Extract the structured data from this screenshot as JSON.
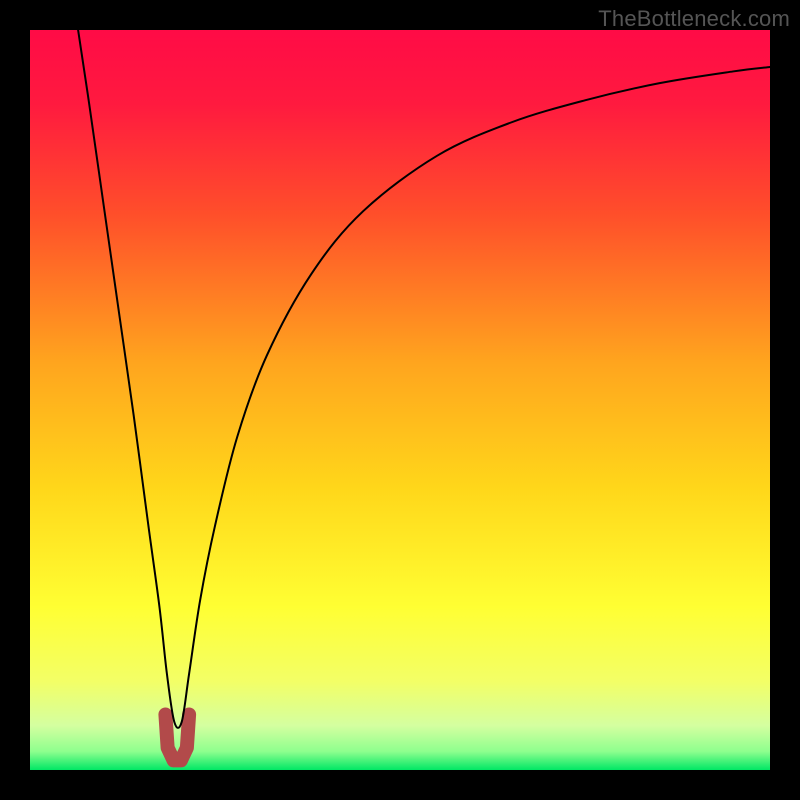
{
  "watermark": "TheBottleneck.com",
  "chart_data": {
    "type": "line",
    "title": "",
    "xlabel": "",
    "ylabel": "",
    "xlim": [
      0,
      100
    ],
    "ylim": [
      0,
      100
    ],
    "gradient_stops": [
      {
        "offset": 0.0,
        "color": "#ff0b46"
      },
      {
        "offset": 0.1,
        "color": "#ff1a3f"
      },
      {
        "offset": 0.25,
        "color": "#ff4f2a"
      },
      {
        "offset": 0.45,
        "color": "#ffa51e"
      },
      {
        "offset": 0.62,
        "color": "#ffd71a"
      },
      {
        "offset": 0.78,
        "color": "#ffff33"
      },
      {
        "offset": 0.88,
        "color": "#f3ff66"
      },
      {
        "offset": 0.94,
        "color": "#d4ffa0"
      },
      {
        "offset": 0.975,
        "color": "#8eff8e"
      },
      {
        "offset": 1.0,
        "color": "#00e765"
      }
    ],
    "series": [
      {
        "name": "bottleneck-curve",
        "stroke": "#000000",
        "stroke_width": 2.0,
        "x": [
          6.5,
          8,
          10,
          12,
          14,
          16,
          17.5,
          18.5,
          19.5,
          20.5,
          21.5,
          23,
          25,
          28,
          32,
          38,
          45,
          55,
          65,
          75,
          85,
          95,
          100
        ],
        "y": [
          100,
          90,
          76,
          62,
          48,
          33,
          22,
          13,
          6.5,
          6.5,
          13,
          23,
          33,
          45,
          56,
          67,
          75.5,
          83,
          87.5,
          90.5,
          92.8,
          94.4,
          95
        ]
      }
    ],
    "marker": {
      "name": "bottleneck-marker",
      "color": "#b24a4a",
      "stroke_width": 14,
      "path_x": [
        18.3,
        18.6,
        19.4,
        20.4,
        21.2,
        21.5
      ],
      "path_y": [
        7.5,
        3.0,
        1.3,
        1.3,
        3.0,
        7.5
      ]
    }
  }
}
